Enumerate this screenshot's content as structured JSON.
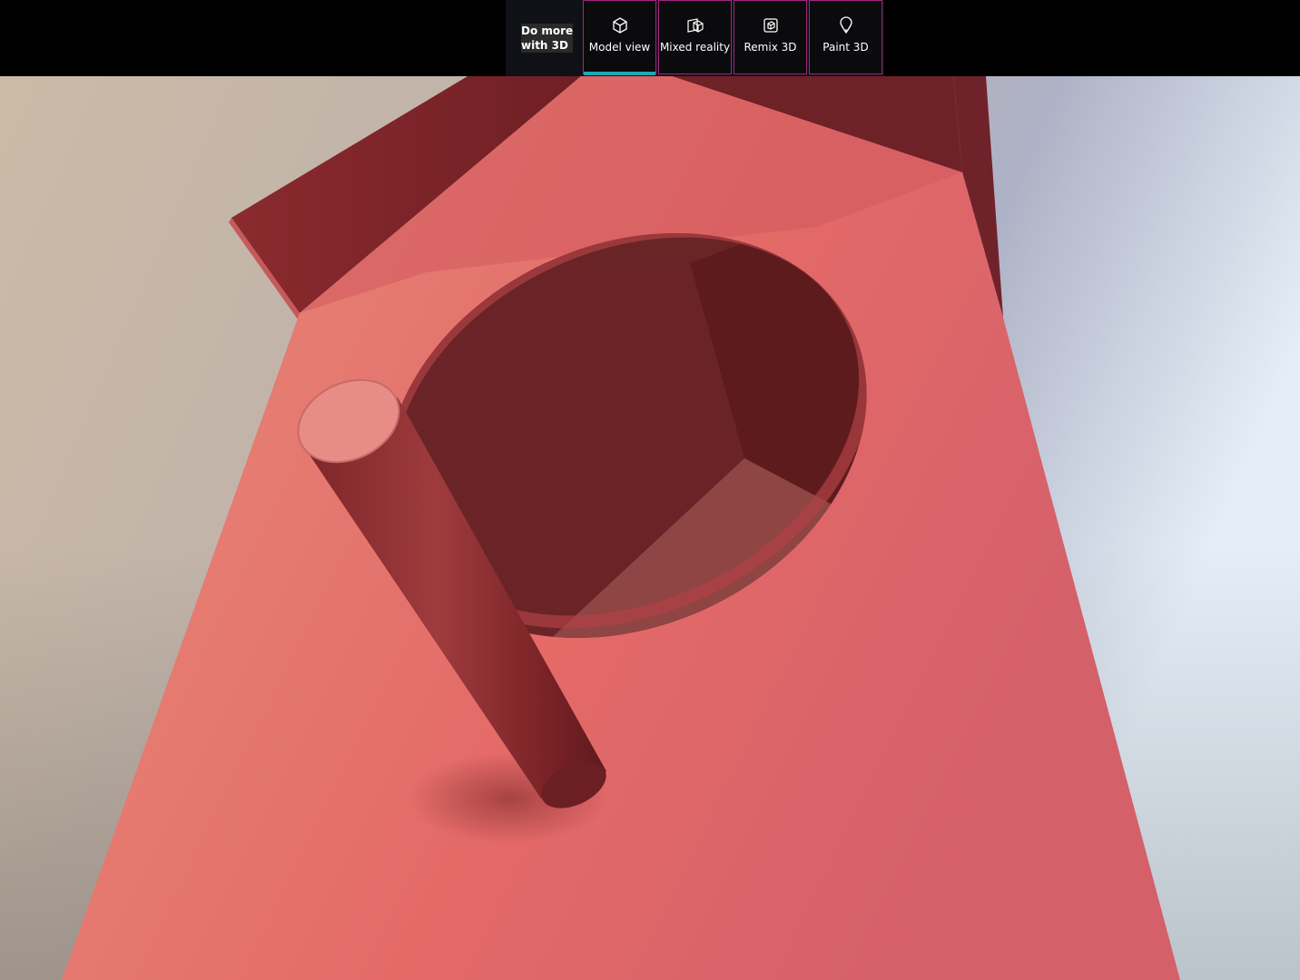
{
  "toolbar": {
    "do_more_label": "Do more\nwith 3D",
    "buttons": [
      {
        "label": "Model view",
        "icon": "cube-icon",
        "active": true
      },
      {
        "label": "Mixed reality",
        "icon": "mixed-reality-icon",
        "active": false
      },
      {
        "label": "Remix 3D",
        "icon": "remix-icon",
        "active": false
      },
      {
        "label": "Paint 3D",
        "icon": "paint-3d-icon",
        "active": false
      }
    ]
  },
  "colors": {
    "accent": "#1fa7b4",
    "button_border": "#a0267e",
    "model_main": "#e06462",
    "model_dark": "#7a2427"
  }
}
